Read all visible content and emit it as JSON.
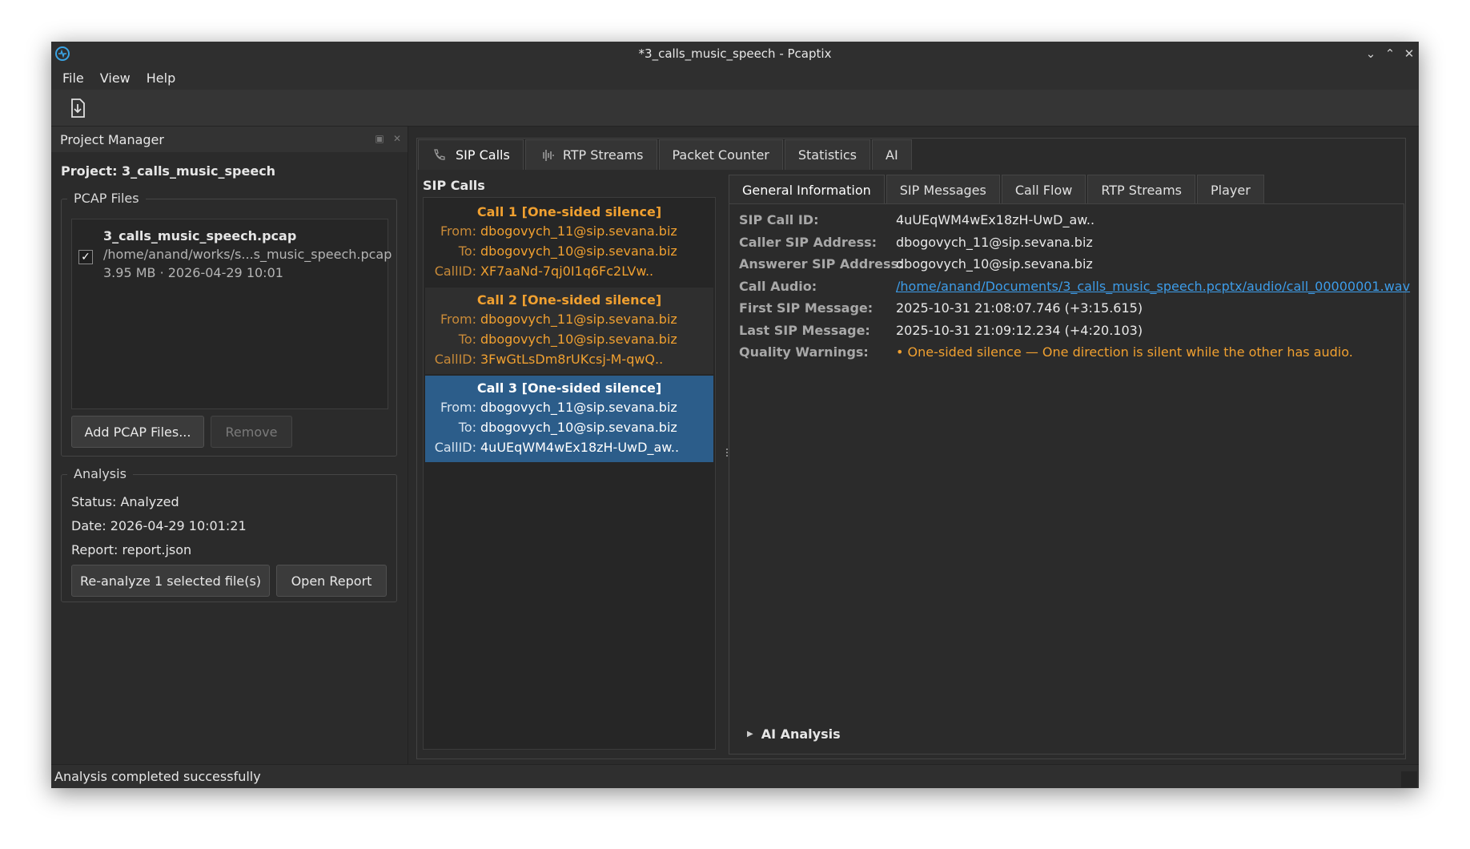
{
  "window": {
    "title": "*3_calls_music_speech - Pcaptix"
  },
  "menu": {
    "items": [
      "File",
      "View",
      "Help"
    ]
  },
  "toolbar": {
    "icon": "export-icon"
  },
  "project_manager": {
    "title": "Project Manager",
    "project_label": "Project: 3_calls_music_speech",
    "pcap_group_title": "PCAP Files",
    "files": [
      {
        "name": "3_calls_music_speech.pcap",
        "path": "/home/anand/works/s...s_music_speech.pcap",
        "meta": "3.95 MB  ·  2026-04-29 10:01",
        "checked": true
      }
    ],
    "add_button": "Add PCAP Files...",
    "remove_button": "Remove",
    "analysis_title": "Analysis",
    "status": "Status: Analyzed",
    "date": "Date: 2026-04-29 10:01:21",
    "report": "Report: report.json",
    "reanalyze_button": "Re-analyze 1 selected file(s)",
    "open_report_button": "Open Report"
  },
  "main_tabs": [
    "SIP Calls",
    "RTP Streams",
    "Packet Counter",
    "Statistics",
    "AI"
  ],
  "sip_calls_header": "SIP Calls",
  "calls": [
    {
      "title": "Call 1 [One-sided silence]",
      "from_label": "From:",
      "from": "dbogovych_11@sip.sevana.biz",
      "to_label": "To:",
      "to": "dbogovych_10@sip.sevana.biz",
      "callid_label": "CallID:",
      "callid": "XF7aaNd-7qj0I1q6Fc2LVw.."
    },
    {
      "title": "Call 2 [One-sided silence]",
      "from_label": "From:",
      "from": "dbogovych_11@sip.sevana.biz",
      "to_label": "To:",
      "to": "dbogovych_10@sip.sevana.biz",
      "callid_label": "CallID:",
      "callid": "3FwGtLsDm8rUKcsj-M-qwQ.."
    },
    {
      "title": "Call 3 [One-sided silence]",
      "from_label": "From:",
      "from": "dbogovych_11@sip.sevana.biz",
      "to_label": "To:",
      "to": "dbogovych_10@sip.sevana.biz",
      "callid_label": "CallID:",
      "callid": "4uUEqWM4wEx18zH-UwD_aw.."
    }
  ],
  "detail_tabs": [
    "General Information",
    "SIP Messages",
    "Call Flow",
    "RTP Streams",
    "Player"
  ],
  "general_info": {
    "sip_call_id_label": "SIP Call ID:",
    "sip_call_id": "4uUEqWM4wEx18zH-UwD_aw..",
    "caller_label": "Caller SIP Address:",
    "caller": "dbogovych_11@sip.sevana.biz",
    "answerer_label": "Answerer SIP Address:",
    "answerer": "dbogovych_10@sip.sevana.biz",
    "audio_label": "Call Audio:",
    "audio": "/home/anand/Documents/3_calls_music_speech.pcptx/audio/call_00000001.wav",
    "first_label": "First SIP Message:",
    "first": "2025-10-31 21:08:07.746  (+3:15.615)",
    "last_label": "Last SIP Message:",
    "last": "2025-10-31 21:09:12.234  (+4:20.103)",
    "warnings_label": "Quality Warnings:",
    "warnings": "• One-sided silence — One direction is silent while the other has audio."
  },
  "ai_analysis_label": "AI Analysis",
  "status_bar": "Analysis completed successfully",
  "colors": {
    "accent_selected": "#2c5d8a",
    "warning": "#f0a030",
    "link": "#3d9ce8"
  }
}
